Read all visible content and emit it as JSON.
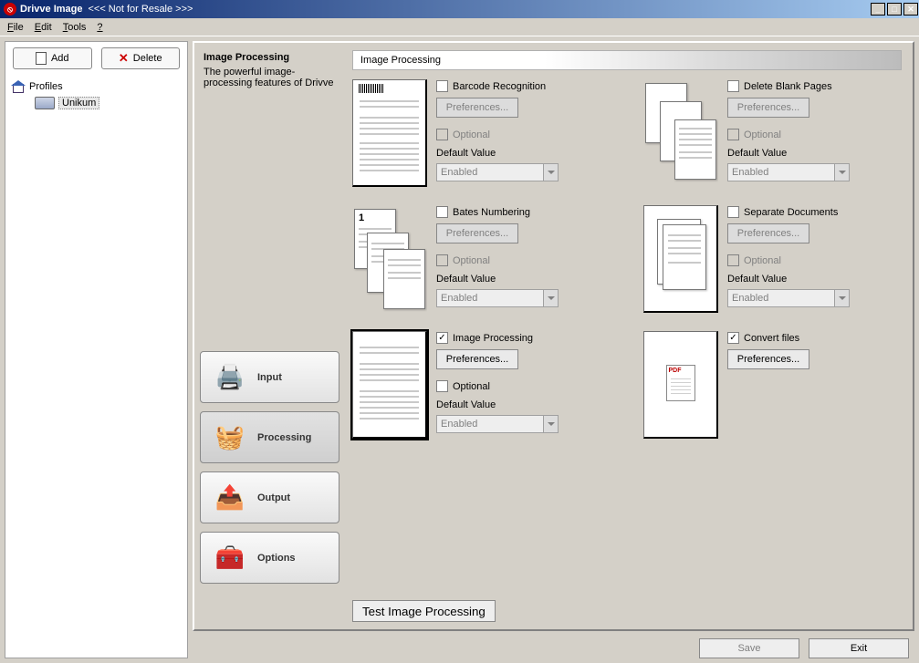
{
  "window": {
    "app_title": "Drivve Image",
    "title_suffix": "<<< Not for Resale >>>"
  },
  "menu": {
    "file": "File",
    "edit": "Edit",
    "tools": "Tools",
    "help": "?"
  },
  "sidebar": {
    "add_label": "Add",
    "delete_label": "Delete",
    "tree": {
      "root": "Profiles",
      "child1": "Unikum"
    }
  },
  "info": {
    "title": "Image Processing",
    "desc": "The powerful image-processing features of Drivve"
  },
  "header": {
    "label": "Image Processing"
  },
  "nav": {
    "input": "Input",
    "processing": "Processing",
    "output": "Output",
    "options": "Options"
  },
  "labels": {
    "preferences": "Preferences...",
    "optional": "Optional",
    "default_value": "Default Value",
    "enabled": "Enabled"
  },
  "options": {
    "barcode": {
      "label": "Barcode Recognition",
      "checked": false,
      "pref_enabled": false,
      "optional_enabled": false,
      "combo_enabled": false
    },
    "delete_blank": {
      "label": "Delete Blank Pages",
      "checked": false,
      "pref_enabled": false,
      "optional_enabled": false,
      "combo_enabled": false
    },
    "bates": {
      "label": "Bates Numbering",
      "checked": false,
      "pref_enabled": false,
      "optional_enabled": false,
      "combo_enabled": false
    },
    "separate": {
      "label": "Separate Documents",
      "checked": false,
      "pref_enabled": false,
      "optional_enabled": false,
      "combo_enabled": false
    },
    "imageproc": {
      "label": "Image Processing",
      "checked": true,
      "pref_enabled": true,
      "optional_enabled": true,
      "combo_enabled": false
    },
    "convert": {
      "label": "Convert files",
      "checked": true,
      "pref_enabled": true
    }
  },
  "buttons": {
    "test": "Test Image Processing",
    "save": "Save",
    "exit": "Exit"
  }
}
